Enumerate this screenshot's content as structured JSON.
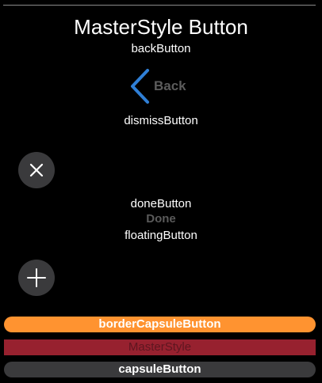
{
  "title": "MasterStyle Button",
  "sections": {
    "back": "backButton",
    "dismiss": "dismissButton",
    "done": "doneButton",
    "floating": "floatingButton"
  },
  "back_button": {
    "label": "Back",
    "icon": "chevron-left-icon",
    "icon_color": "#2f7fd6"
  },
  "dismiss_button": {
    "icon": "close-icon"
  },
  "done_button": {
    "label": "Done"
  },
  "floating_button": {
    "icon": "plus-icon"
  },
  "border_capsule_button": {
    "label": "borderCapsuleButton",
    "color": "#ff9330"
  },
  "masterstyle_button": {
    "label": "MasterStyle",
    "color": "#97212f"
  },
  "capsule_button": {
    "label": "capsuleButton",
    "color": "#3a3a3c"
  }
}
